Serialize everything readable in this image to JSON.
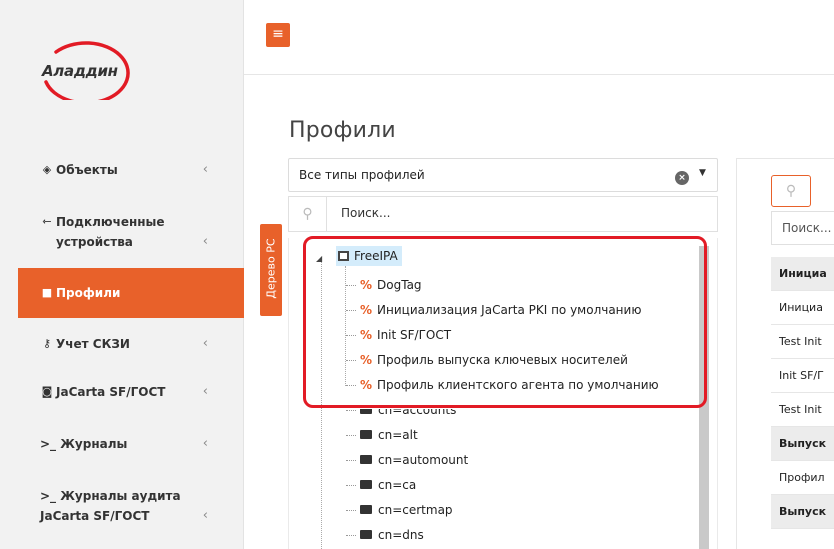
{
  "logo": {
    "text": "Аладдин"
  },
  "sidebar": {
    "items": [
      {
        "label": "Объекты",
        "icon": "diamond-icon",
        "icon_glyph": "◈",
        "chevron": "‹"
      },
      {
        "label": "Подключенные устройства",
        "icon": "usb-icon",
        "icon_glyph": "⇽",
        "chevron": "‹"
      },
      {
        "label": "Профили",
        "icon": "folder-icon",
        "icon_glyph": "■"
      },
      {
        "label": "Учет СКЗИ",
        "icon": "key-icon",
        "icon_glyph": "⚷",
        "chevron": "‹"
      },
      {
        "label": "JaCarta SF/ГОСТ",
        "icon": "shield-icon",
        "icon_glyph": "◙",
        "chevron": "‹"
      },
      {
        "label": ">_ Журналы",
        "chevron": "‹"
      },
      {
        "label": ">_ Журналы аудита JaCarta SF/ГОСТ",
        "chevron": "‹"
      }
    ]
  },
  "header": {
    "menu_glyph": "≡"
  },
  "page": {
    "title": "Профили"
  },
  "filter": {
    "selected": "Все типы профилей",
    "clear_glyph": "×",
    "caret": "▼"
  },
  "search": {
    "placeholder": "Поиск...",
    "icon_glyph": "⚲"
  },
  "tree_tab": {
    "label": "Дерево РС"
  },
  "tree": {
    "root": "FreeIPA",
    "profiles": [
      "DogTag",
      "Инициализация JaCarta PKI по умолчанию",
      "Init SF/ГОСТ",
      "Профиль выпуска ключевых носителей",
      "Профиль клиентского агента по умолчанию"
    ],
    "containers": [
      "cn=accounts",
      "cn=alt",
      "cn=automount",
      "cn=ca",
      "cn=certmap",
      "cn=dns"
    ]
  },
  "right_panel": {
    "search_placeholder": "Поиск...",
    "rows": [
      {
        "text": "Инициа",
        "group": true
      },
      {
        "text": "Инициа",
        "group": false
      },
      {
        "text": "Test Init",
        "group": false
      },
      {
        "text": "Init SF/Г",
        "group": false
      },
      {
        "text": "Test Init",
        "group": false
      },
      {
        "text": "Выпуск",
        "group": true
      },
      {
        "text": "Профил",
        "group": false
      },
      {
        "text": "Выпуск",
        "group": true
      }
    ]
  },
  "colors": {
    "accent": "#e8612a",
    "highlight": "#e21b25",
    "selected_node": "#d4ecfb"
  }
}
